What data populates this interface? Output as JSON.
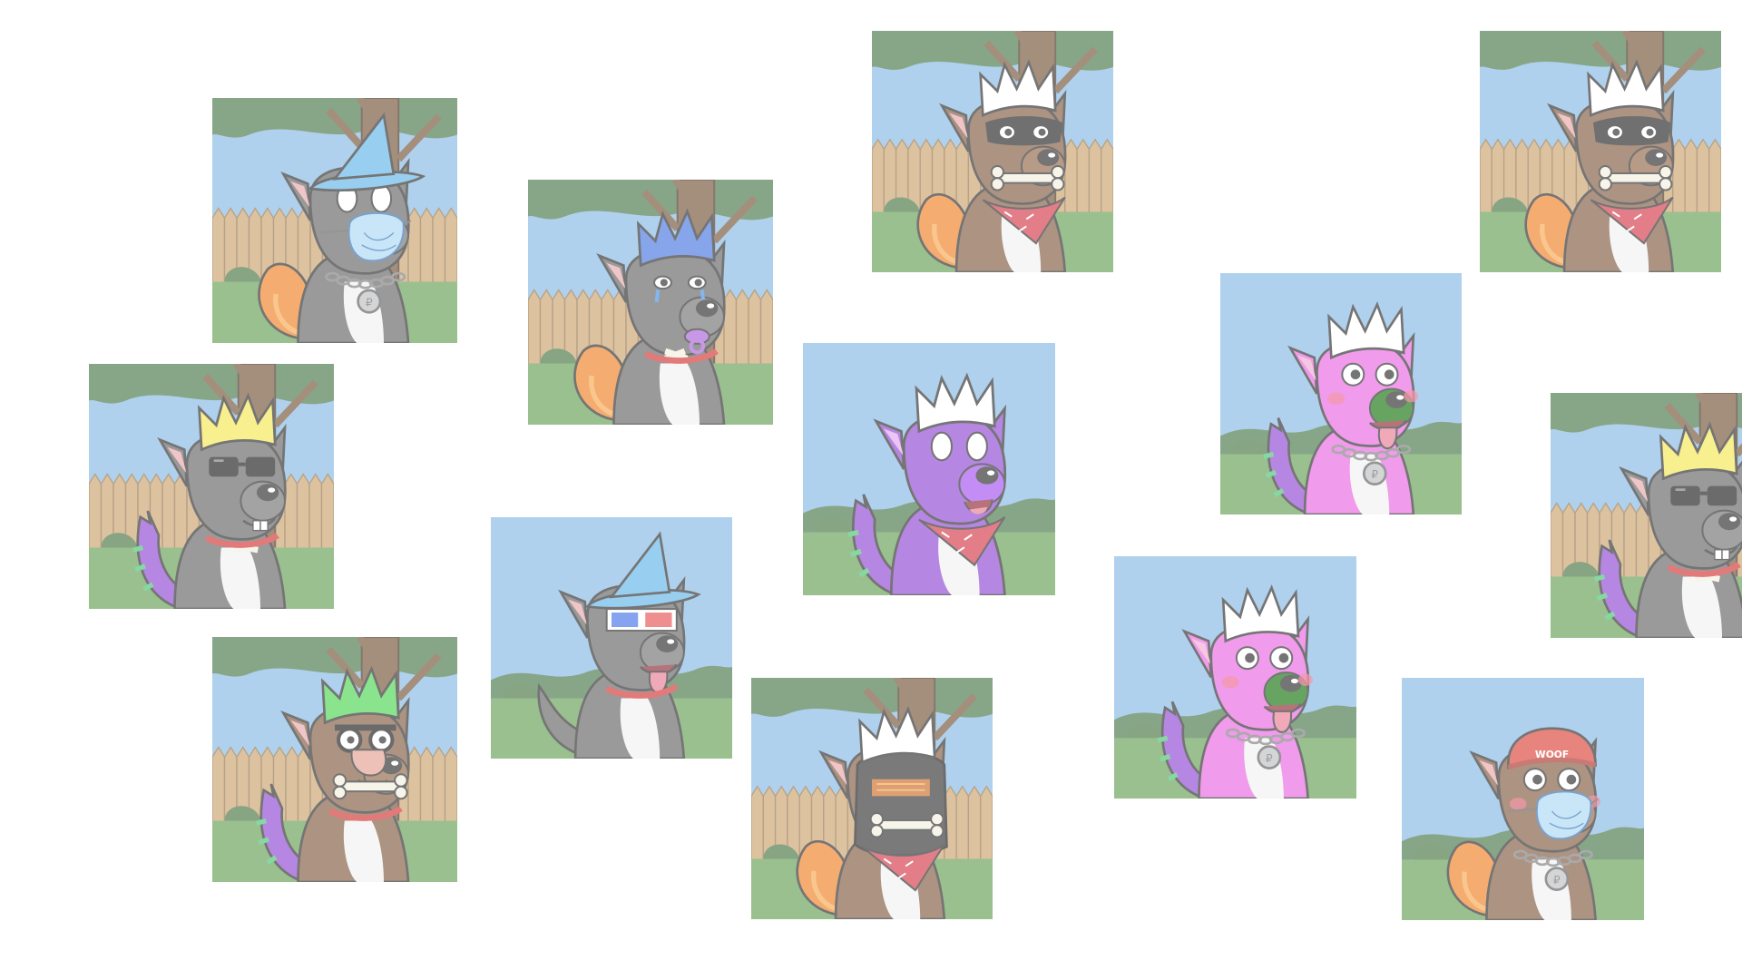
{
  "tiles": [
    {
      "scene": "yard",
      "hat": "wizard",
      "hat_color": "#5ab1e6",
      "fur": "#5d5d5d",
      "ear": "#e8a2a6",
      "tail": "fox",
      "eyes": "blank",
      "mouth": "mask",
      "collar": "chain",
      "tag": "#b9bcc0"
    },
    {
      "scene": "yard",
      "hat": "crown",
      "hat_color": "#3e6fe0",
      "fur": "#5d5d5d",
      "ear": "#e8a2a6",
      "tail": "fox",
      "eyes": "teary",
      "mouth": "pacifier",
      "collar": "red",
      "tag": ""
    },
    {
      "scene": "yard",
      "hat": "crown",
      "hat_color": "#ffffff",
      "fur": "#7a5236",
      "ear": "#e8a2a6",
      "tail": "fox",
      "eyes": "mask",
      "mouth": "bone",
      "collar": "bandana",
      "tag": ""
    },
    {
      "scene": "yard",
      "hat": "crown",
      "hat_color": "#ffffff",
      "fur": "#7a5236",
      "ear": "#e8a2a6",
      "tail": "fox",
      "eyes": "mask",
      "mouth": "bone",
      "collar": "bandana",
      "tag": ""
    },
    {
      "scene": "yard",
      "hat": "crown",
      "hat_color": "#f4e64a",
      "fur": "#5d5d5d",
      "ear": "#e8a2a6",
      "tail": "dragon",
      "eyes": "shades",
      "mouth": "teeth",
      "collar": "red",
      "tag": ""
    },
    {
      "scene": "sky",
      "hat": "crown",
      "hat_color": "#ffffff",
      "fur": "#e85ee0",
      "ear": "#f1a6cf",
      "tail": "dragon",
      "eyes": "wide",
      "mouth": "tongue",
      "collar": "chain",
      "tag": "#b9bcc0"
    },
    {
      "scene": "sky",
      "hat": "crown",
      "hat_color": "#ffffff",
      "fur": "#8a3fd1",
      "ear": "#e0a3f0",
      "tail": "dragon",
      "eyes": "blank",
      "mouth": "open",
      "collar": "bandana",
      "tag": ""
    },
    {
      "scene": "sky",
      "hat": "wizard",
      "hat_color": "#5ab1e6",
      "fur": "#5d5d5d",
      "ear": "#e8a2a6",
      "tail": "plain",
      "eyes": "3d",
      "mouth": "tongue",
      "collar": "red",
      "tag": ""
    },
    {
      "scene": "yard",
      "hat": "crown",
      "hat_color": "#f4e64a",
      "fur": "#5d5d5d",
      "ear": "#e8a2a6",
      "tail": "dragon",
      "eyes": "shades",
      "mouth": "teeth",
      "collar": "red",
      "tag": ""
    },
    {
      "scene": "yard",
      "hat": "crown",
      "hat_color": "#44d44a",
      "fur": "#7a5236",
      "ear": "#e8a2a6",
      "tail": "dragon",
      "eyes": "groucho",
      "mouth": "bone",
      "collar": "red",
      "tag": ""
    },
    {
      "scene": "yard",
      "hat": "crown",
      "hat_color": "#ffffff",
      "fur": "#7a5236",
      "ear": "#e8a2a6",
      "tail": "fox",
      "eyes": "welder",
      "mouth": "bone",
      "collar": "bandana",
      "tag": ""
    },
    {
      "scene": "sky",
      "hat": "crown",
      "hat_color": "#ffffff",
      "fur": "#e85ee0",
      "ear": "#f1a6cf",
      "tail": "dragon",
      "eyes": "wide",
      "mouth": "tongue",
      "collar": "chain",
      "tag": "#b9bcc0"
    },
    {
      "scene": "sky",
      "hat": "beanie",
      "hat_color": "#d83a2e",
      "hat_text": "WOOF",
      "fur": "#7a5236",
      "ear": "#e8a2a6",
      "tail": "fox",
      "eyes": "wide",
      "mouth": "mask",
      "collar": "chain",
      "tag": "#b9bcc0"
    }
  ]
}
